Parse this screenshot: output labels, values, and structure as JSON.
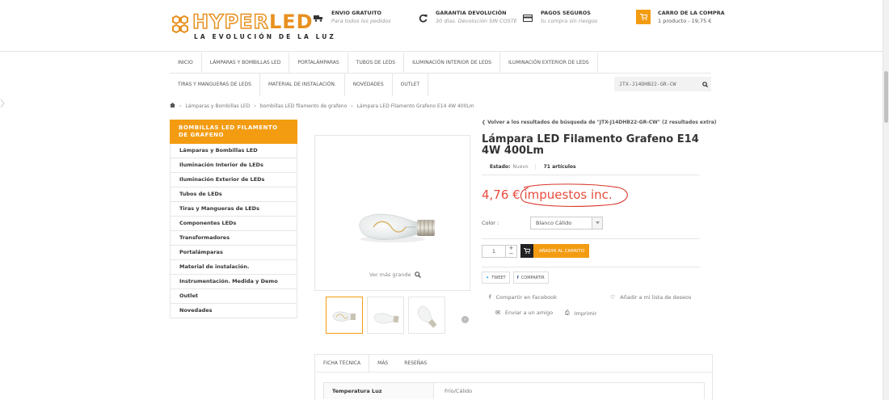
{
  "header": {
    "logo": {
      "brand_part1": "HYPER",
      "brand_part2": "LED",
      "tagline": "LA EVOLUCIÓN DE LA LUZ"
    },
    "info": [
      {
        "icon": "truck-icon",
        "title": "ENVIO GRATUITO",
        "subtitle": "Para todos los pedidos"
      },
      {
        "icon": "refresh-icon",
        "title": "GARANTIA DEVOLUCIÓN",
        "subtitle": "30 días. Devolución SIN COSTE"
      },
      {
        "icon": "credit-card-icon",
        "title": "PAGOS SEGUROS",
        "subtitle": "tu compra sin riesgos"
      }
    ],
    "cart": {
      "title": "CARRO DE LA COMPRA",
      "summary": "1 producto - 19,75 €"
    }
  },
  "nav": {
    "row1": [
      "INICIO",
      "LÁMPARAS Y BOMBILLAS LED",
      "PORTALÁMPARAS",
      "TUBOS DE LEDS",
      "ILUMINACIÓN INTERIOR DE LEDS",
      "ILUMINACIÓN EXTERIOR DE LEDS"
    ],
    "row2": [
      "TIRAS Y MANGUERAS DE LEDS",
      "MATERIAL DE INSTALACIÓN.",
      "NOVEDADES",
      "OUTLET"
    ],
    "search_value": "JTX-J14DHB22-GR-CW"
  },
  "breadcrumb": {
    "items": [
      "Lámparas y Bombillas LED",
      "bombillas LED filamento de grafeno",
      "Lámpara LED Filamento Grafeno E14 4W 400Lm"
    ]
  },
  "sidebar": {
    "heading": "BOMBILLAS LED FILAMENTO DE GRAFENO",
    "categories": [
      "Lámparas y Bombillas LED",
      "Iluminación Interior de LEDs",
      "Iluminación Exterior de LEDs",
      "Tubos de LEDs",
      "Tiras y Mangueras de LEDs",
      "Componentes LEDs",
      "Transformadores",
      "Portalámparas",
      "Material de instalación.",
      "Instrumentación. Medida y Demo",
      "Outlet",
      "Novedades"
    ]
  },
  "product": {
    "back_link": "❮ Volver a los resultados de búsqueda de \"JTX-J14DHB22-GR-CW\" (2 resultados extra)",
    "title": "Lámpara LED Filamento Grafeno E14 4W 400Lm",
    "estado_label": "Estado:",
    "estado_value": "Nuevo",
    "stock": "71 artículos",
    "price": "4,76 €",
    "tax_note": "impuestos inc.",
    "color_label": "Color :",
    "color_value": "Blanco Cálido",
    "quantity": "1",
    "add_to_cart": "AÑADIR AL CARRITO",
    "view_larger": "Ver más grande",
    "share": {
      "tweet": "TWEET",
      "share": "COMPARTIR"
    },
    "links": {
      "facebook": "Compartir en Facebook",
      "wishlist": "Añadir a mi lista de deseos",
      "send_friend": "Enviar a un amigo",
      "print": "Imprimir"
    }
  },
  "tabs": {
    "items": [
      "FICHA TÉCNICA",
      "MÁS",
      "RESEÑAS"
    ],
    "spec_key": "Temperatura Luz",
    "spec_value": "Frío/Cálido"
  },
  "colors": {
    "accent": "#f39c12",
    "price": "#e74c3c",
    "annotation": "#d9362b"
  }
}
